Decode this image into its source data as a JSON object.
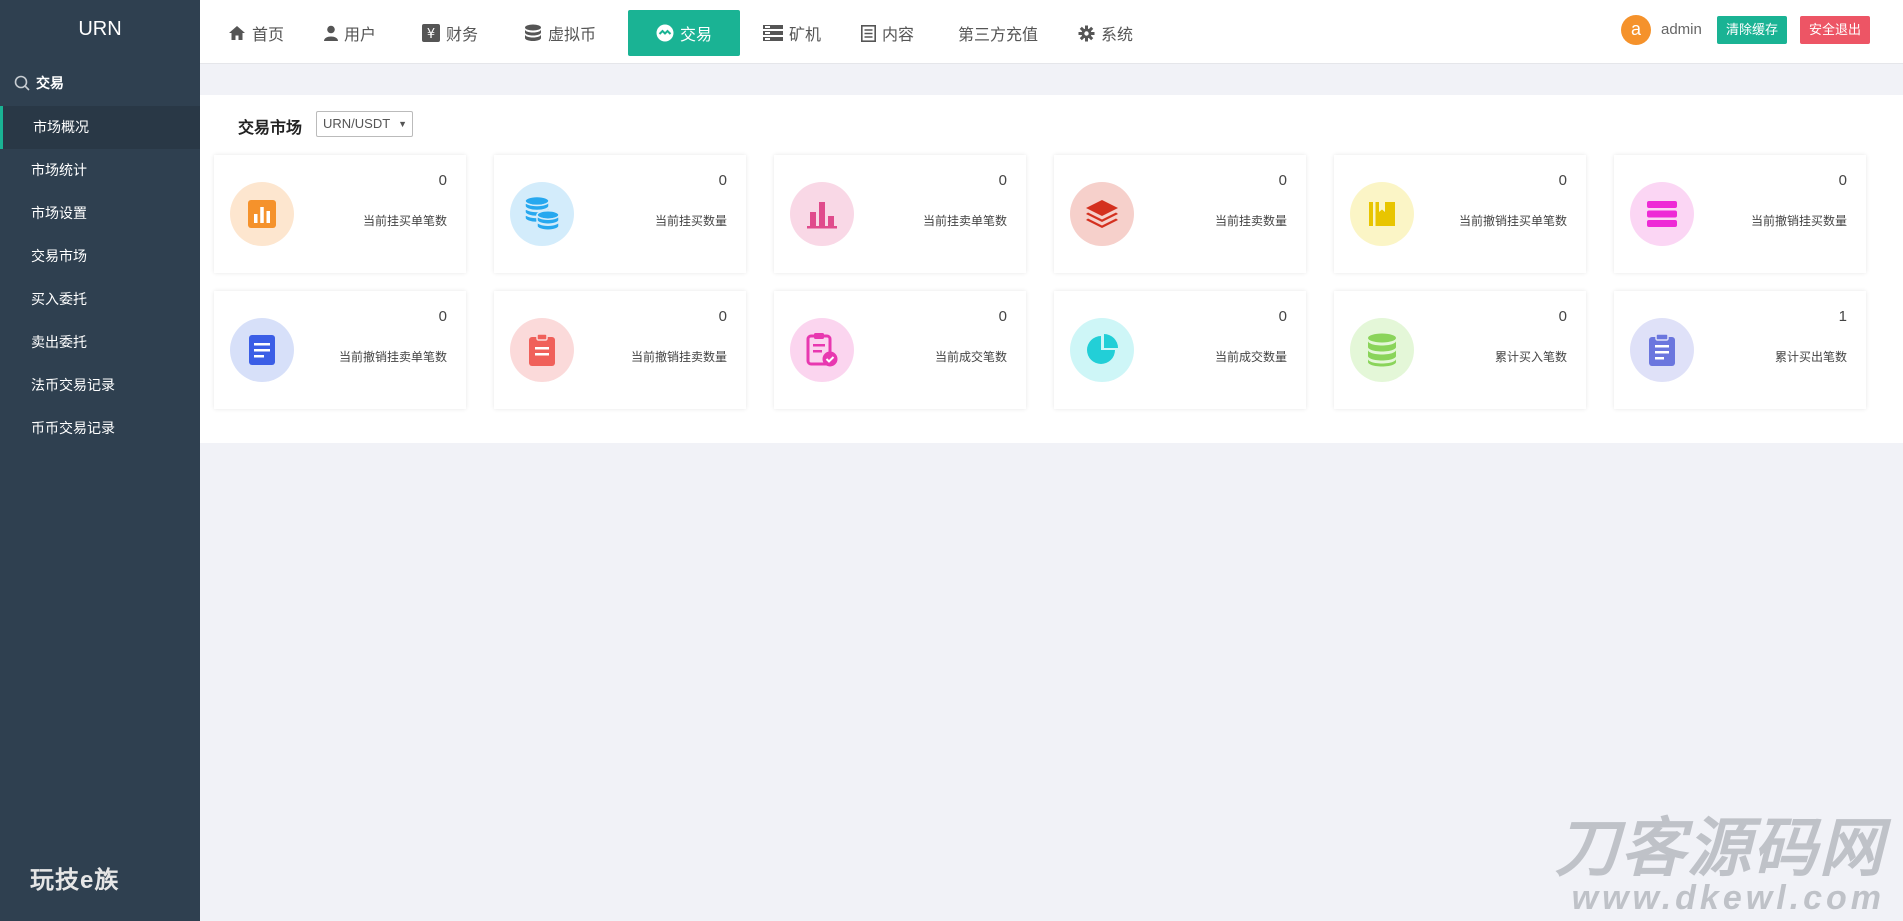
{
  "sidebar": {
    "brand": "URN",
    "section": "交易",
    "items": [
      {
        "label": "市场概况",
        "active": true
      },
      {
        "label": "市场统计"
      },
      {
        "label": "市场设置"
      },
      {
        "label": "交易市场"
      },
      {
        "label": "买入委托"
      },
      {
        "label": "卖出委托"
      },
      {
        "label": "法币交易记录"
      },
      {
        "label": "币币交易记录"
      }
    ],
    "logo_text": "玩技e族"
  },
  "topnav": {
    "items": [
      {
        "label": "首页",
        "icon": "home-icon"
      },
      {
        "label": "用户",
        "icon": "user-icon"
      },
      {
        "label": "财务",
        "icon": "yen-icon"
      },
      {
        "label": "虚拟币",
        "icon": "database-icon"
      },
      {
        "label": "交易",
        "icon": "exchange-icon",
        "active": true
      },
      {
        "label": "矿机",
        "icon": "server-icon"
      },
      {
        "label": "内容",
        "icon": "document-icon"
      },
      {
        "label": "第三方充值",
        "icon": ""
      },
      {
        "label": "系统",
        "icon": "gear-icon"
      }
    ],
    "avatar_letter": "a",
    "username": "admin",
    "clear_cache": "清除缓存",
    "logout": "安全退出"
  },
  "main": {
    "market_label": "交易市场",
    "market_select": "URN/USDT",
    "cards": [
      {
        "value": "0",
        "label": "当前挂买单笔数",
        "icon": "bar-chart-icon",
        "color": "#f5922b",
        "bg": "#fde6cf"
      },
      {
        "value": "0",
        "label": "当前挂买数量",
        "icon": "coins-icon",
        "color": "#27a8ef",
        "bg": "#d3ecfb"
      },
      {
        "value": "0",
        "label": "当前挂卖单笔数",
        "icon": "column-chart-icon",
        "color": "#e04b8c",
        "bg": "#f9d8e6"
      },
      {
        "value": "0",
        "label": "当前挂卖数量",
        "icon": "layers-icon",
        "color": "#d4301f",
        "bg": "#f6d0cb"
      },
      {
        "value": "0",
        "label": "当前撤销挂买单笔数",
        "icon": "book-icon",
        "color": "#e8c500",
        "bg": "#fbf5c6"
      },
      {
        "value": "0",
        "label": "当前撤销挂买数量",
        "icon": "stack-bars-icon",
        "color": "#ee2ad6",
        "bg": "#fbd6f4"
      },
      {
        "value": "0",
        "label": "当前撤销挂卖单笔数",
        "icon": "doc-list-icon",
        "color": "#3b5ee6",
        "bg": "#d7e0f9"
      },
      {
        "value": "0",
        "label": "当前撤销挂卖数量",
        "icon": "clipboard-icon",
        "color": "#f0605a",
        "bg": "#fbdada"
      },
      {
        "value": "0",
        "label": "当前成交笔数",
        "icon": "clipboard-check-icon",
        "color": "#e838b0",
        "bg": "#fbd5ef"
      },
      {
        "value": "0",
        "label": "当前成交数量",
        "icon": "pie-chart-icon",
        "color": "#22cfd7",
        "bg": "#cef6f7"
      },
      {
        "value": "0",
        "label": "累计买入笔数",
        "icon": "cylinder-icon",
        "color": "#8ad45a",
        "bg": "#e4f7d8"
      },
      {
        "value": "1",
        "label": "累计买出笔数",
        "icon": "clipboard-lines-icon",
        "color": "#6b76de",
        "bg": "#dfe1f8"
      }
    ]
  },
  "watermark": {
    "line1": "刀客源码网",
    "line2": "www.dkewl.com"
  },
  "colors": {
    "sidebar_bg": "#2f4050",
    "accent": "#1ab394",
    "danger": "#ed5565",
    "page_bg": "#f1f2f7"
  }
}
